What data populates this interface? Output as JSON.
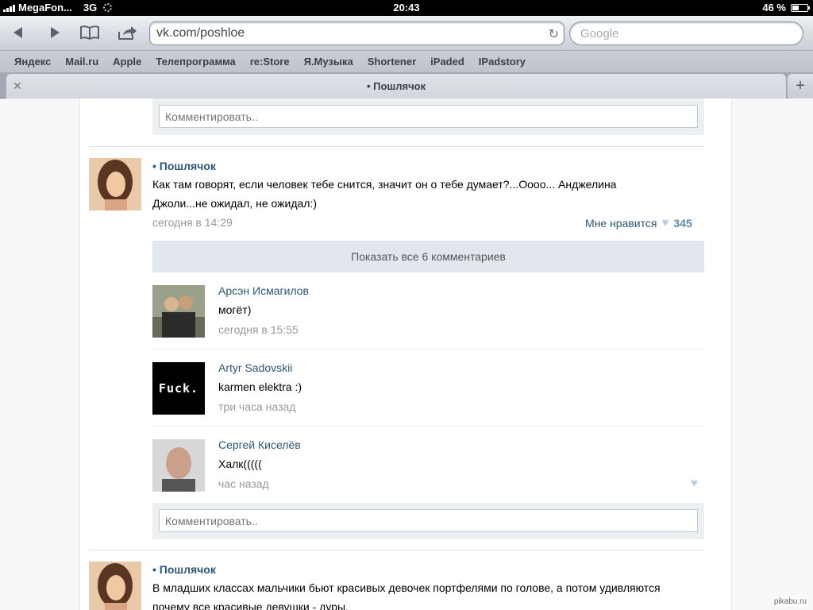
{
  "status_bar": {
    "carrier": "MegaFon...",
    "network": "3G",
    "time": "20:43",
    "battery": "46 %",
    "battery_level": 0.46
  },
  "browser": {
    "url": "vk.com/poshloe",
    "search_placeholder": "Google",
    "bookmarks": [
      "Яндекс",
      "Mail.ru",
      "Apple",
      "Телепрограмма",
      "re:Store",
      "Я.Музыка",
      "Shortener",
      "iPaded",
      "IPadstory"
    ],
    "tab_title": "• Пошлячок"
  },
  "feed": {
    "comment_placeholder": "Комментировать..",
    "posts": [
      {
        "author": "• Пошлячок",
        "text": "Как там говорят, если человек тебе снится, значит он о тебе думает?...Оооо... Анджелина Джоли...не ожидал, не ожидал:)",
        "date": "сегодня в 14:29",
        "like_label": "Мне нравится",
        "like_count": "345",
        "show_all": "Показать все 6 комментариев",
        "comments": [
          {
            "author": "Арсэн Исмагилов",
            "text": "могёт)",
            "date": "сегодня в 15:55"
          },
          {
            "author": "Artyr Sadovskii",
            "text": "karmen elektra :)",
            "date": "три часа назад",
            "avatar_text": "Fuck."
          },
          {
            "author": "Сергей Киселёв",
            "text": "Халк(((((",
            "date": "час назад"
          }
        ]
      },
      {
        "author": "• Пошлячок",
        "text": "В младших классах мальчики бьют красивых девочек портфелями по голове, а потом удивляются почему все красивые девушки - дуры."
      }
    ]
  },
  "watermark": "pikabu.ru"
}
